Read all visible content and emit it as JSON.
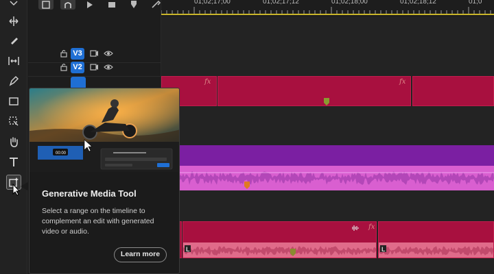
{
  "ruler": {
    "timecodes": [
      "01;02;17;00",
      "01;02;17;12",
      "01;02;18;00",
      "01;02;18;12",
      "01;0"
    ]
  },
  "tracks": [
    {
      "label": "V3",
      "locked": true
    },
    {
      "label": "V2",
      "locked": true
    }
  ],
  "tools": [
    "selection-tool",
    "ripple-edit-tool",
    "razor-tool",
    "slip-tool",
    "pen-tool",
    "rectangle-tool",
    "remix-tool",
    "hand-tool",
    "type-tool",
    "generative-media-tool"
  ],
  "popup": {
    "title": "Generative Media Tool",
    "description": "Select a range on the timeline to complement an edit with generated video or audio.",
    "learn_more_label": "Learn more",
    "preview_timecode": "00:00"
  },
  "colors": {
    "accent_blue": "#1f6fd4",
    "video_clip": "#a8103f",
    "audio_purple": "#7b1fa2",
    "audio_pink": "#e06bc8",
    "playhead_yellow": "#c9b52a"
  }
}
